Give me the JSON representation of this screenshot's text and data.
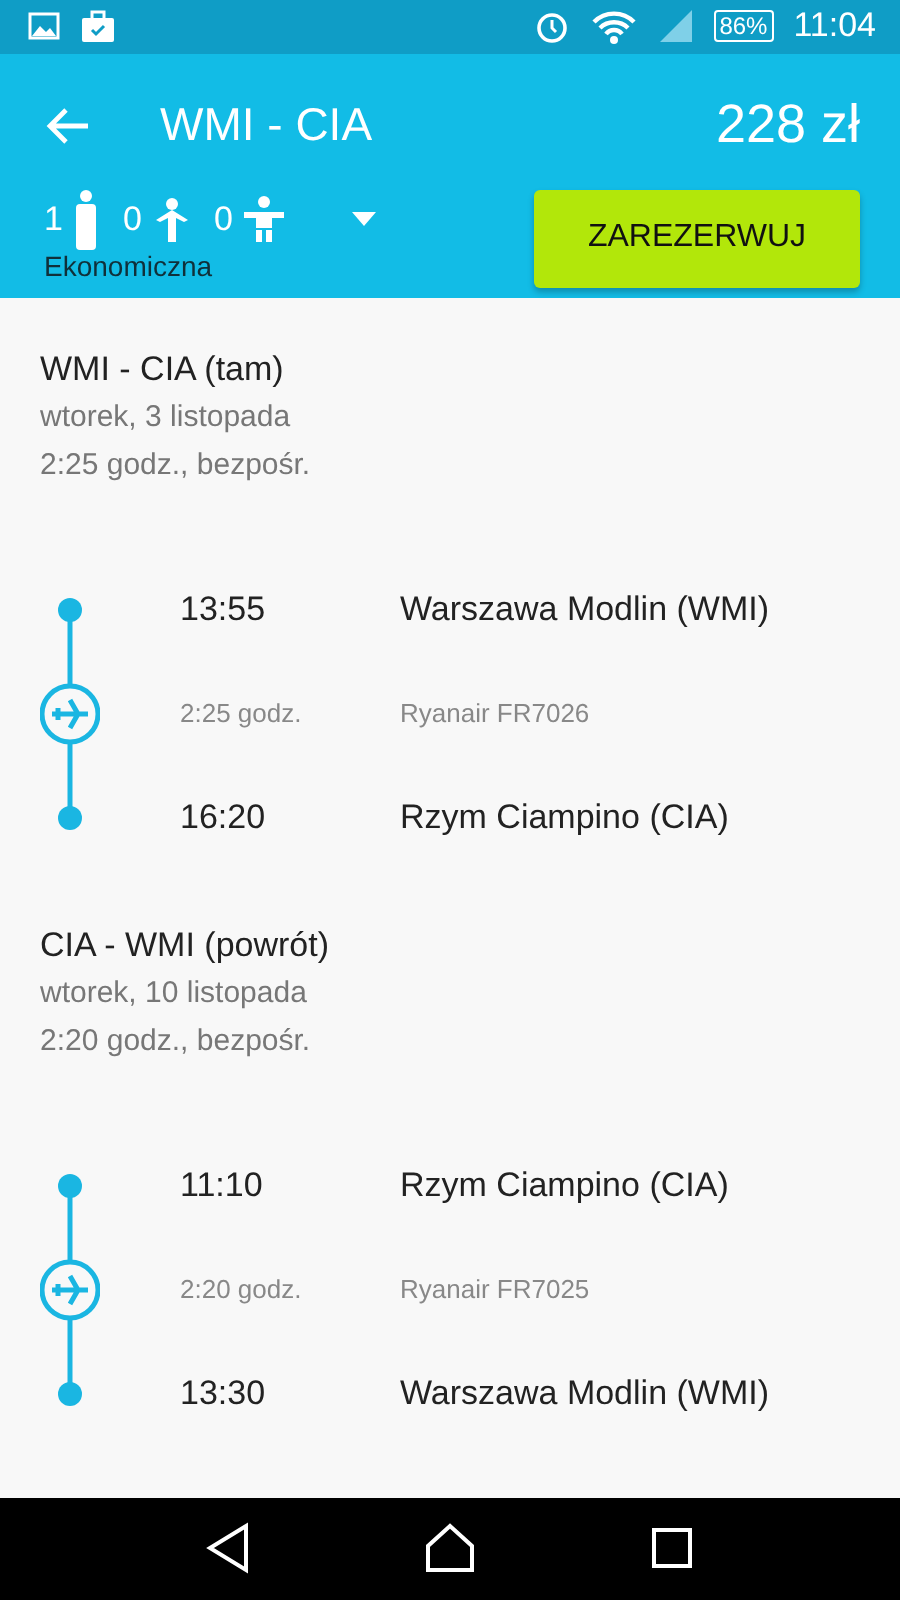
{
  "status_bar": {
    "battery": "86%",
    "time": "11:04"
  },
  "header": {
    "title": "WMI - CIA",
    "price": "228 zł",
    "cabin": "Ekonomiczna",
    "book_button": "ZAREZERWUJ",
    "passengers": [
      {
        "kind": "adult",
        "count": "1"
      },
      {
        "kind": "child",
        "count": "0"
      },
      {
        "kind": "infant",
        "count": "0"
      }
    ]
  },
  "legs": [
    {
      "title": "WMI - CIA (tam)",
      "date": "wtorek, 3 listopada",
      "summary": "2:25 godz., bezpośr.",
      "departure_time": "13:55",
      "departure_airport": "Warszawa Modlin (WMI)",
      "duration": "2:25 godz.",
      "flight": "Ryanair FR7026",
      "arrival_time": "16:20",
      "arrival_airport": "Rzym Ciampino (CIA)"
    },
    {
      "title": "CIA - WMI (powrót)",
      "date": "wtorek, 10 listopada",
      "summary": "2:20 godz., bezpośr.",
      "departure_time": "11:10",
      "departure_airport": "Rzym Ciampino (CIA)",
      "duration": "2:20 godz.",
      "flight": "Ryanair FR7025",
      "arrival_time": "13:30",
      "arrival_airport": "Warszawa Modlin (WMI)"
    }
  ]
}
